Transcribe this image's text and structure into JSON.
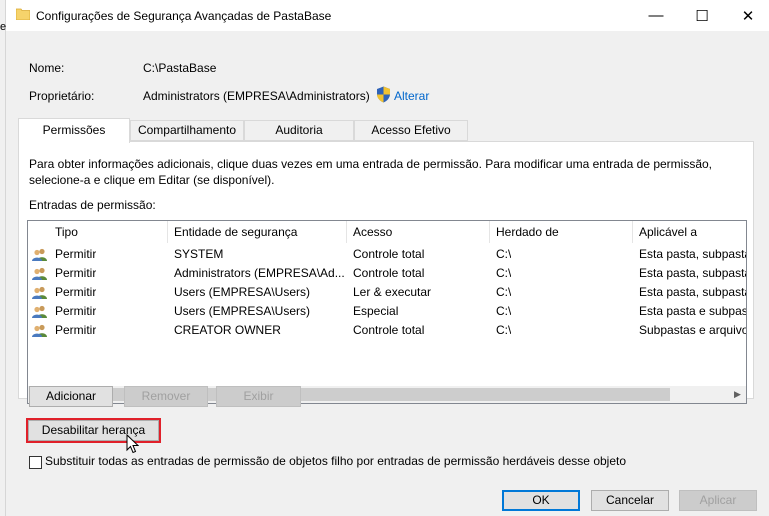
{
  "window": {
    "title": "Configurações de Segurança Avançadas de PastaBase",
    "left_edge_text": "e",
    "buttons": {
      "minimize": "—",
      "maximize": "☐",
      "close": "✕"
    }
  },
  "info": {
    "name_label": "Nome:",
    "name_value": "C:\\PastaBase",
    "owner_label": "Proprietário:",
    "owner_value": "Administrators (EMPRESA\\Administrators)",
    "change_link": "Alterar"
  },
  "tabs": [
    {
      "label": "Permissões",
      "active": true
    },
    {
      "label": "Compartilhamento",
      "active": false
    },
    {
      "label": "Auditoria",
      "active": false
    },
    {
      "label": "Acesso Efetivo",
      "active": false
    }
  ],
  "instructions": {
    "line1": "Para obter informações adicionais, clique duas vezes em uma entrada de permissão. Para modificar uma entrada de permissão,",
    "line2": "selecione-a e clique em Editar (se disponível)."
  },
  "entries_label": "Entradas de permissão:",
  "table": {
    "headers": [
      "Tipo",
      "Entidade de segurança",
      "Acesso",
      "Herdado de",
      "Aplicável a"
    ],
    "rows": [
      [
        "Permitir",
        "SYSTEM",
        "Controle total",
        "C:\\",
        "Esta pasta, subpastas e arquivos"
      ],
      [
        "Permitir",
        "Administrators (EMPRESA\\Ad...",
        "Controle total",
        "C:\\",
        "Esta pasta, subpastas e arquivos"
      ],
      [
        "Permitir",
        "Users (EMPRESA\\Users)",
        "Ler & executar",
        "C:\\",
        "Esta pasta, subpastas e arquivos"
      ],
      [
        "Permitir",
        "Users (EMPRESA\\Users)",
        "Especial",
        "C:\\",
        "Esta pasta e subpastas"
      ],
      [
        "Permitir",
        "CREATOR OWNER",
        "Controle total",
        "C:\\",
        "Subpastas e arquivos somente"
      ]
    ]
  },
  "actions": {
    "add": "Adicionar",
    "remove": "Remover",
    "view": "Exibir",
    "disable_inheritance": "Desabilitar herança"
  },
  "replace_checkbox_label": "Substituir todas as entradas de permissão de objetos filho por entradas de permissão herdáveis desse objeto",
  "footer": {
    "ok": "OK",
    "cancel": "Cancelar",
    "apply": "Aplicar"
  },
  "colors": {
    "highlight": "#e0202a",
    "link": "#0066cc",
    "default_button_border": "#0078d7"
  }
}
